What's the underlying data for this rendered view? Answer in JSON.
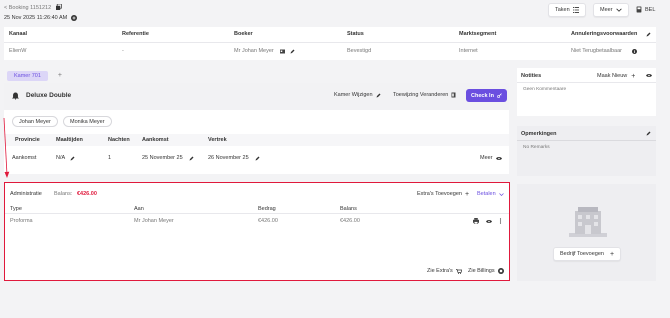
{
  "header": {
    "back_label": "< Booking 1151212",
    "datetime": "25 Nov 2025 11:26:40 AM",
    "tasks_button": "Taken",
    "more_button": "Meer",
    "call_label": "BEL"
  },
  "booking_table": {
    "columns": [
      "Kanaal",
      "Referentie",
      "Boeker",
      "Status",
      "Marktsegment",
      "Annuleringsvoorwaarden"
    ],
    "row": [
      "ElienW",
      "-",
      "Mr Johan Meyer",
      "Bevestigd",
      "Internet",
      "Niet Terugbetaalbaar"
    ]
  },
  "room_tabs": {
    "active_tab": "Kamer 701",
    "add_tab": "+"
  },
  "room": {
    "type": "Deluxe Double",
    "change_room": "Kamer Wijzigen",
    "change_assignment": "Toewijzing Veranderen",
    "checkin": "Check In",
    "guests": [
      "Johan Meyer",
      "Monika Meyer"
    ],
    "table_columns": [
      "Provincie",
      "Maaltijden",
      "Nachten",
      "Aankomst",
      "Vertrek"
    ],
    "table_row": [
      "Aankomst",
      "N/A",
      "1",
      "25 November 25",
      "26 November 25"
    ],
    "row_more": "Meer"
  },
  "administration": {
    "title": "Administratie",
    "balance_label": "Balans:",
    "balance_value": "€426.00",
    "add_extras": "Extra's Toevoegen",
    "pay": "Betalen",
    "columns": [
      "Type",
      "Aan",
      "Bedrag",
      "Balans"
    ],
    "row": [
      "Proforma",
      "Mr Johan Meyer",
      "€426.00",
      "€426.00"
    ],
    "see_extras": "Zie Extra's",
    "see_billings": "Zie Billings"
  },
  "notes": {
    "title": "Notities",
    "new": "Maak Nieuw",
    "empty": "Geen Kommentaare"
  },
  "remarks": {
    "title": "Opmerkingen",
    "empty": "No Remarks"
  },
  "company": {
    "add_button": "Bedrijf Toevoegen"
  },
  "colors": {
    "accent": "#6b4fe0",
    "highlight": "#e0193c"
  }
}
